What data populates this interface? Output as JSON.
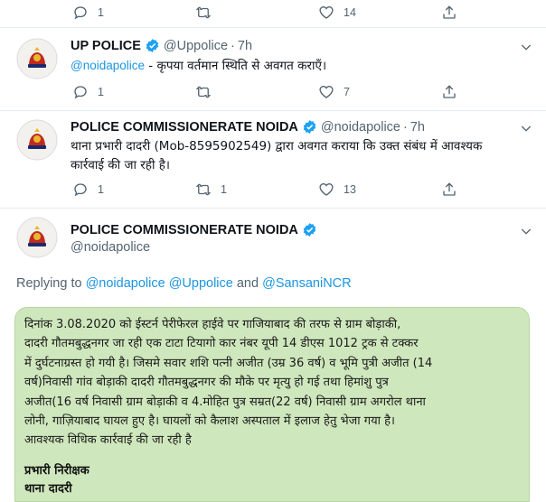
{
  "top_actions": {
    "reply_count": "1",
    "retweet_count": "",
    "like_count": "14",
    "share_count": ""
  },
  "tweet1": {
    "name": "UP POLICE",
    "handle": "@Uppolice",
    "time": "7h",
    "mention": "@noidapolice",
    "text": " - कृपया वर्तमान स्थिति से अवगत कराएँ।",
    "actions": {
      "reply_count": "1",
      "retweet_count": "",
      "like_count": "7"
    }
  },
  "tweet2": {
    "name": "POLICE COMMISSIONERATE NOIDA",
    "handle": "@noidapolice",
    "time": "7h",
    "text_line1": "थाना प्रभारी दादरी (Mob-8595902549) द्वारा अवगत कराया कि उक्त संबंध में आवश्यक",
    "text_line2": "कार्रवाई की जा रही है।",
    "actions": {
      "reply_count": "1",
      "retweet_count": "1",
      "like_count": "13"
    }
  },
  "tweet3": {
    "name": "POLICE COMMISSIONERATE NOIDA",
    "handle": "@noidapolice",
    "replying_prefix": "Replying to ",
    "reply_mention_1": "@noidapolice",
    "reply_mention_2": "@Uppolice",
    "reply_and": " and ",
    "reply_mention_3": "@SansaniNCR"
  },
  "image_text": {
    "line1": "दिनांक 3.08.2020 को ईस्टर्न पेरीफेरल हाईवे पर गाजियाबाद की तरफ से ग्राम बोड़ाकी,",
    "line2": "दादरी गौतमबुद्धनगर जा रही एक टाटा टियागो कार नंबर यूपी 14 डीएस 1012 ट्रक से टक्कर",
    "line3": "में दुर्घटनाग्रस्त हो गयी है। जिसमे सवार शशि पत्नी अजीत (उम्र 36 वर्ष) व भूमि पुत्री अजीत (14",
    "line4": "वर्ष)निवासी गांव बोड़ाकी दादरी गौतमबुद्धनगर की मौके पर मृत्यु हो गई तथा हिमांशु पुत्र",
    "line5": "अजीत(16 वर्ष निवासी  ग्राम बोड़ाकी व 4.मोहित पुत्र सम्रत(22 वर्ष) निवासी ग्राम अगरोल थाना",
    "line6": "लोनी, गाज़ियाबाद घायल हुए है। घायलों को कैलाश अस्पताल में इलाज हेतु भेजा गया है।",
    "line7": "आवश्यक विधिक कार्रवाई की जा रही है",
    "sign1": "प्रभारी निरीक्षक",
    "sign2": "थाना दादरी"
  },
  "colors": {
    "link": "#1b95e0",
    "verified": "#1da1f2",
    "image_bg": "#cfe7bd",
    "muted": "#536471"
  }
}
